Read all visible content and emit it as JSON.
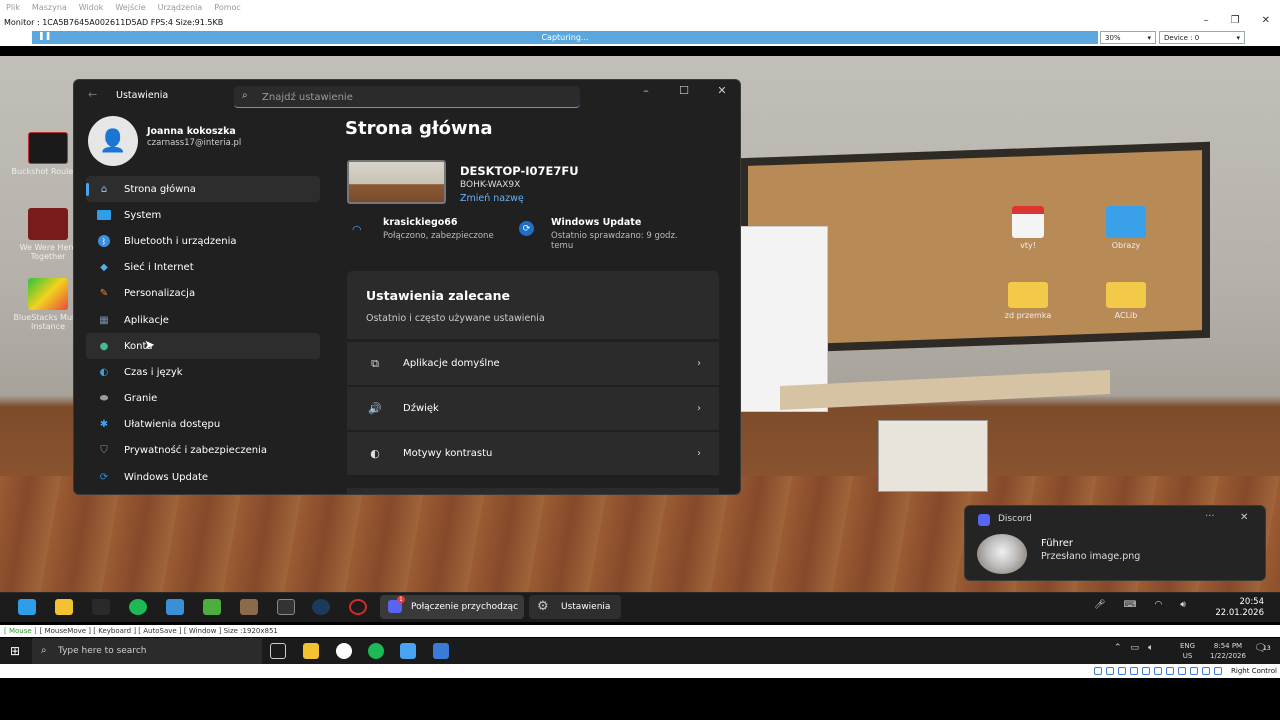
{
  "host": {
    "menu": [
      "Plik",
      "Maszyna",
      "Widok",
      "Wejście",
      "Urządzenia",
      "Pomoc"
    ],
    "window_title": "Monitor : 1CA5B7645A002611D5AD  FPS:4  Size:91.5KB",
    "capture_status": "Capturing...",
    "zoom": "30%",
    "device": "Device : 0",
    "status_line": {
      "mouse": "[ Mouse ]",
      "rest": "[ MouseMove ]  [ Keyboard ]  [ AutoSave ]  [ Window ]  Size :1920x851"
    },
    "search_placeholder": "Type here to search",
    "lang": "ENG",
    "region": "US",
    "time": "8:54 PM",
    "date": "1/22/2026",
    "right_control": "Right Control",
    "notif_count": "13"
  },
  "desktop": {
    "left_icons": [
      "Buckshot Roulette",
      "We Were Here Together",
      "BlueStacks Multi-Instance"
    ],
    "right_icons": [
      "vty!",
      "Obrazy",
      "zd przemka",
      "ACLib"
    ]
  },
  "settings": {
    "window_title": "Ustawienia",
    "search_placeholder": "Znajdź ustawienie",
    "user_name": "Joanna kokoszka",
    "user_email": "czarnass17@interia.pl",
    "nav": [
      {
        "label": "Strona główna",
        "icon": "home-icon",
        "color": "#9fc6ec"
      },
      {
        "label": "System",
        "icon": "system-icon",
        "color": "#2f9ee8"
      },
      {
        "label": "Bluetooth i urządzenia",
        "icon": "bluetooth-icon",
        "color": "#3b8fe0"
      },
      {
        "label": "Sieć i Internet",
        "icon": "network-icon",
        "color": "#4fb1e6"
      },
      {
        "label": "Personalizacja",
        "icon": "brush-icon",
        "color": "#e08a3c"
      },
      {
        "label": "Aplikacje",
        "icon": "apps-icon",
        "color": "#7a8fa8"
      },
      {
        "label": "Konta",
        "icon": "accounts-icon",
        "color": "#3fbf8f"
      },
      {
        "label": "Czas i język",
        "icon": "time-language-icon",
        "color": "#3b9ee0"
      },
      {
        "label": "Granie",
        "icon": "gaming-icon",
        "color": "#9a9a9a"
      },
      {
        "label": "Ułatwienia dostępu",
        "icon": "accessibility-icon",
        "color": "#4aa3f0"
      },
      {
        "label": "Prywatność i zabezpieczenia",
        "icon": "shield-icon",
        "color": "#8a8a8a"
      },
      {
        "label": "Windows Update",
        "icon": "windows-update-icon",
        "color": "#2f8fe0"
      }
    ],
    "page_title": "Strona główna",
    "pc_name": "DESKTOP-I07E7FU",
    "pc_model": "BOHK-WAX9X",
    "rename_link": "Zmień nazwę",
    "wifi_name": "krasickiego66",
    "wifi_status": "Połączono, zabezpieczone",
    "update_title": "Windows Update",
    "update_status": "Ostatnio sprawdzano: 9 godz. temu",
    "recommended_title": "Ustawienia zalecane",
    "recommended_sub": "Ostatnio i często używane ustawienia",
    "recommended": [
      {
        "label": "Aplikacje domyślne",
        "icon": "default-apps-icon"
      },
      {
        "label": "Dźwięk",
        "icon": "speaker-icon"
      },
      {
        "label": "Motywy kontrastu",
        "icon": "contrast-icon"
      }
    ]
  },
  "toast": {
    "app": "Discord",
    "from": "Führer",
    "message": "Przesłano image.png"
  },
  "remote_taskbar": {
    "call_label": "Połączenie przychodząc",
    "call_badge": "1",
    "settings_label": "Ustawienia",
    "time": "20:54",
    "date": "22.01.2026"
  }
}
